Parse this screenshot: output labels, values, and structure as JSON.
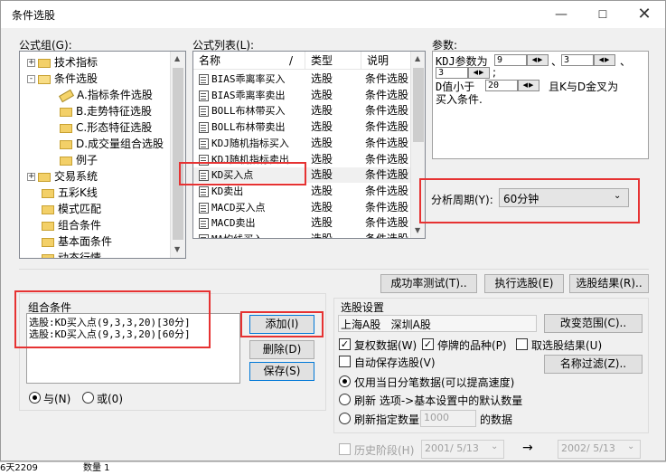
{
  "window": {
    "title": "条件选股"
  },
  "formula_group": {
    "label": "公式组(G):",
    "items": [
      {
        "label": "技术指标",
        "expander": "+"
      },
      {
        "label": "条件选股",
        "expander": "-"
      },
      {
        "label": "A.指标条件选股"
      },
      {
        "label": "B.走势特征选股"
      },
      {
        "label": "C.形态特征选股"
      },
      {
        "label": "D.成交量组合选股"
      },
      {
        "label": "例子"
      },
      {
        "label": "交易系统",
        "expander": "+"
      },
      {
        "label": "五彩K线"
      },
      {
        "label": "模式匹配"
      },
      {
        "label": "组合条件"
      },
      {
        "label": "基本面条件"
      },
      {
        "label": "动态行情"
      }
    ]
  },
  "formula_list": {
    "label": "公式列表(L):",
    "columns": [
      "名称",
      "类型",
      "说明"
    ],
    "sort_indicator": "/",
    "rows": [
      {
        "name": "BIAS乖离率买入",
        "type": "选股",
        "desc": "条件选股"
      },
      {
        "name": "BIAS乖离率卖出",
        "type": "选股",
        "desc": "条件选股"
      },
      {
        "name": "BOLL布林带买入",
        "type": "选股",
        "desc": "条件选股"
      },
      {
        "name": "BOLL布林带卖出",
        "type": "选股",
        "desc": "条件选股"
      },
      {
        "name": "KDJ随机指标买入",
        "type": "选股",
        "desc": "条件选股"
      },
      {
        "name": "KDJ随机指标卖出",
        "type": "选股",
        "desc": "条件选股"
      },
      {
        "name": "KD买入点",
        "type": "选股",
        "desc": "条件选股"
      },
      {
        "name": "KD卖出",
        "type": "选股",
        "desc": "条件选股"
      },
      {
        "name": "MACD买入点",
        "type": "选股",
        "desc": "条件选股"
      },
      {
        "name": "MACD卖出",
        "type": "选股",
        "desc": "条件选股"
      },
      {
        "name": "MA均线买入",
        "type": "选股",
        "desc": "条件选股"
      }
    ]
  },
  "params": {
    "label": "参数:",
    "line1_prefix": "KDJ参数为",
    "p1": "9",
    "sep1": "、",
    "p2": "3",
    "sep2": "、",
    "p3": "3",
    "line2_tail": ";",
    "line3_prefix": "D值小于",
    "p4": "20",
    "line3_suffix": "且K与D金叉为",
    "line4": "买入条件."
  },
  "period": {
    "label": "分析周期(Y):",
    "value": "60分钟"
  },
  "buttons": {
    "success_test": "成功率测试(T)..",
    "execute": "执行选股(E)",
    "result": "选股结果(R)..",
    "add": "添加(I)",
    "delete": "删除(D)",
    "save": "保存(S)",
    "change_range": "改变范围(C)..",
    "name_filter": "名称过滤(Z).."
  },
  "combo": {
    "label": "组合条件",
    "lines": [
      "选股:KD买入点(9,3,3,20)[30分]",
      "选股:KD买入点(9,3,3,20)[60分]"
    ],
    "and": "与(N)",
    "or": "或(0)"
  },
  "settings": {
    "label": "选股设置",
    "range": "上海A股   深圳A股",
    "rights": "复权数据(W)",
    "suspended": "停牌的品种(P)",
    "pick_result": "取选股结果(U)",
    "auto_save": "自动保存选股(V)",
    "only_today": "仅用当日分笔数据(可以提高速度)",
    "refresh_default": "刷新 选项->基本设置中的默认数量",
    "refresh_count": "刷新指定数量",
    "count_value": "1000",
    "count_suffix": "的数据"
  },
  "history": {
    "label": "历史阶段(H)",
    "from": "2001/ 5/13",
    "arrow": "→",
    "to": "2002/ 5/13"
  },
  "background": {
    "left": "6天2209",
    "mid": "数量 1"
  }
}
